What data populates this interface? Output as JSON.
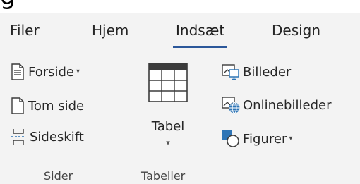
{
  "top_strip": {
    "glyph": "g"
  },
  "tabs": [
    {
      "label": "Filer",
      "active": false
    },
    {
      "label": "Hjem",
      "active": false
    },
    {
      "label": "Indsæt",
      "active": true
    },
    {
      "label": "Design",
      "active": false
    }
  ],
  "groups": {
    "sider": {
      "label": "Sider",
      "items": [
        {
          "label": "Forside",
          "dropdown": "▾",
          "icon": "cover-page-icon"
        },
        {
          "label": "Tom side",
          "icon": "blank-page-icon"
        },
        {
          "label": "Sideskift",
          "icon": "page-break-icon"
        }
      ]
    },
    "tabeller": {
      "label": "Tabeller",
      "table_button": {
        "label": "Tabel",
        "dropdown": "▾",
        "icon": "table-icon"
      }
    },
    "illustrationer": {
      "items": [
        {
          "label": "Billeder",
          "icon": "pictures-icon"
        },
        {
          "label": "Onlinebilleder",
          "icon": "online-pictures-icon"
        },
        {
          "label": "Figurer",
          "dropdown": "▾",
          "icon": "shapes-icon"
        }
      ]
    }
  },
  "colors": {
    "accent": "#2b579a",
    "ribbon_bg": "#f3f3f3",
    "icon_blue": "#2e75b6"
  }
}
